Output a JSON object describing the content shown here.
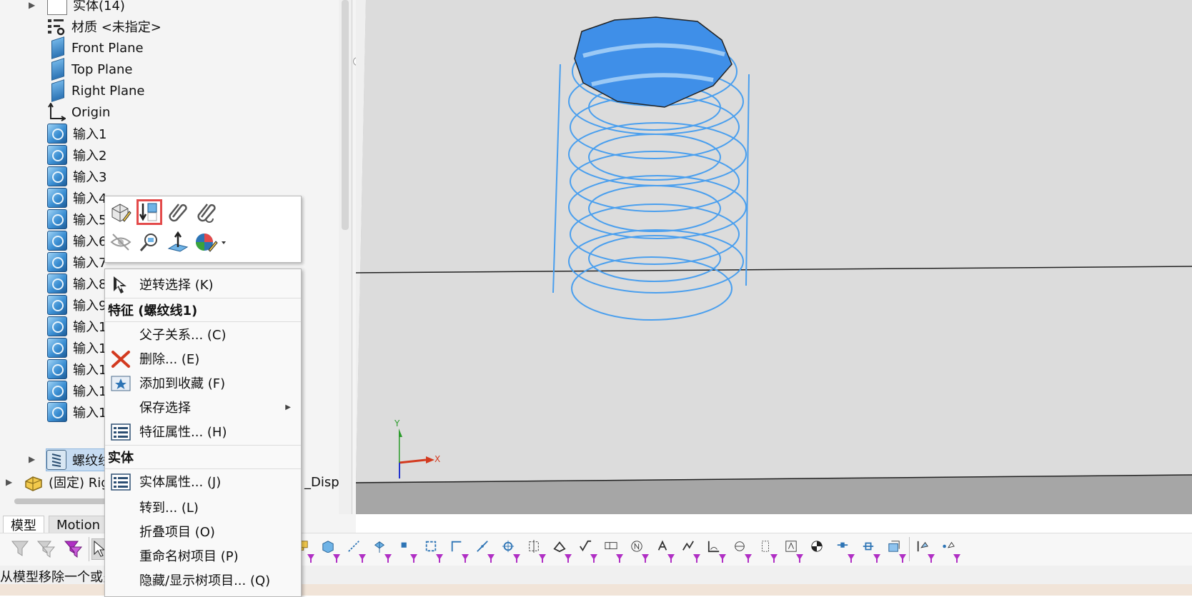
{
  "feature_tree": {
    "items": [
      {
        "label": "实体(14)",
        "icon": "solid-bodies-folder-icon"
      },
      {
        "label": "材质 <未指定>",
        "icon": "material-icon"
      },
      {
        "label": "Front Plane",
        "icon": "plane-icon"
      },
      {
        "label": "Top Plane",
        "icon": "plane-icon"
      },
      {
        "label": "Right Plane",
        "icon": "plane-icon"
      },
      {
        "label": "Origin",
        "icon": "origin-icon"
      },
      {
        "label": "输入1",
        "icon": "imported-body-icon"
      },
      {
        "label": "输入2",
        "icon": "imported-body-icon"
      },
      {
        "label": "输入3",
        "icon": "imported-body-icon"
      },
      {
        "label": "输入4",
        "icon": "imported-body-icon"
      },
      {
        "label": "输入5",
        "icon": "imported-body-icon"
      },
      {
        "label": "输入6",
        "icon": "imported-body-icon"
      },
      {
        "label": "输入7",
        "icon": "imported-body-icon"
      },
      {
        "label": "输入8",
        "icon": "imported-body-icon"
      },
      {
        "label": "输入9",
        "icon": "imported-body-icon"
      },
      {
        "label": "输入1",
        "icon": "imported-body-icon"
      },
      {
        "label": "输入1",
        "icon": "imported-body-icon"
      },
      {
        "label": "输入1",
        "icon": "imported-body-icon"
      },
      {
        "label": "输入1",
        "icon": "imported-body-icon"
      },
      {
        "label": "输入1",
        "icon": "imported-body-icon"
      },
      {
        "label": "螺纹线",
        "icon": "thread-feature-icon",
        "selected": true
      }
    ],
    "assembly_row": {
      "label": "(固定) Rig",
      "suffix": "_Disp",
      "icon": "part-icon"
    }
  },
  "bottom_tabs": {
    "model": "模型",
    "motion": "Motion"
  },
  "context_toolbar": {
    "row1": [
      "edit-feature-icon",
      "rollback-icon",
      "attach-icon",
      "detach-icon"
    ],
    "row2": [
      "hide-icon",
      "zoom-to-selection-icon",
      "normal-to-icon",
      "appearance-icon"
    ],
    "highlight_color": "#e34a4a"
  },
  "context_menu": {
    "invert_selection": "逆转选择 (K)",
    "header_feature": "特征 (螺纹线1)",
    "parent_child": "父子关系... (C)",
    "delete": "删除... (E)",
    "add_to_favorites": "添加到收藏 (F)",
    "save_selection": "保存选择",
    "feature_properties": "特征属性... (H)",
    "header_body": "实体",
    "body_properties": "实体属性... (J)",
    "go_to": "转到... (L)",
    "collapse_items": "折叠项目 (O)",
    "rename_tree_item": "重命名树项目 (P)",
    "hide_show_tree_items": "隐藏/显示树项目... (Q)"
  },
  "triad": {
    "x": "X",
    "y": "Y"
  },
  "status_bar": {
    "text": "从模型移除一个或多个项目。"
  },
  "colors": {
    "thread_blue": "#4a9fee",
    "viewport_bg": "#dcdcdc",
    "delete_red": "#d33a1f",
    "filter_purple": "#b02fc4"
  }
}
